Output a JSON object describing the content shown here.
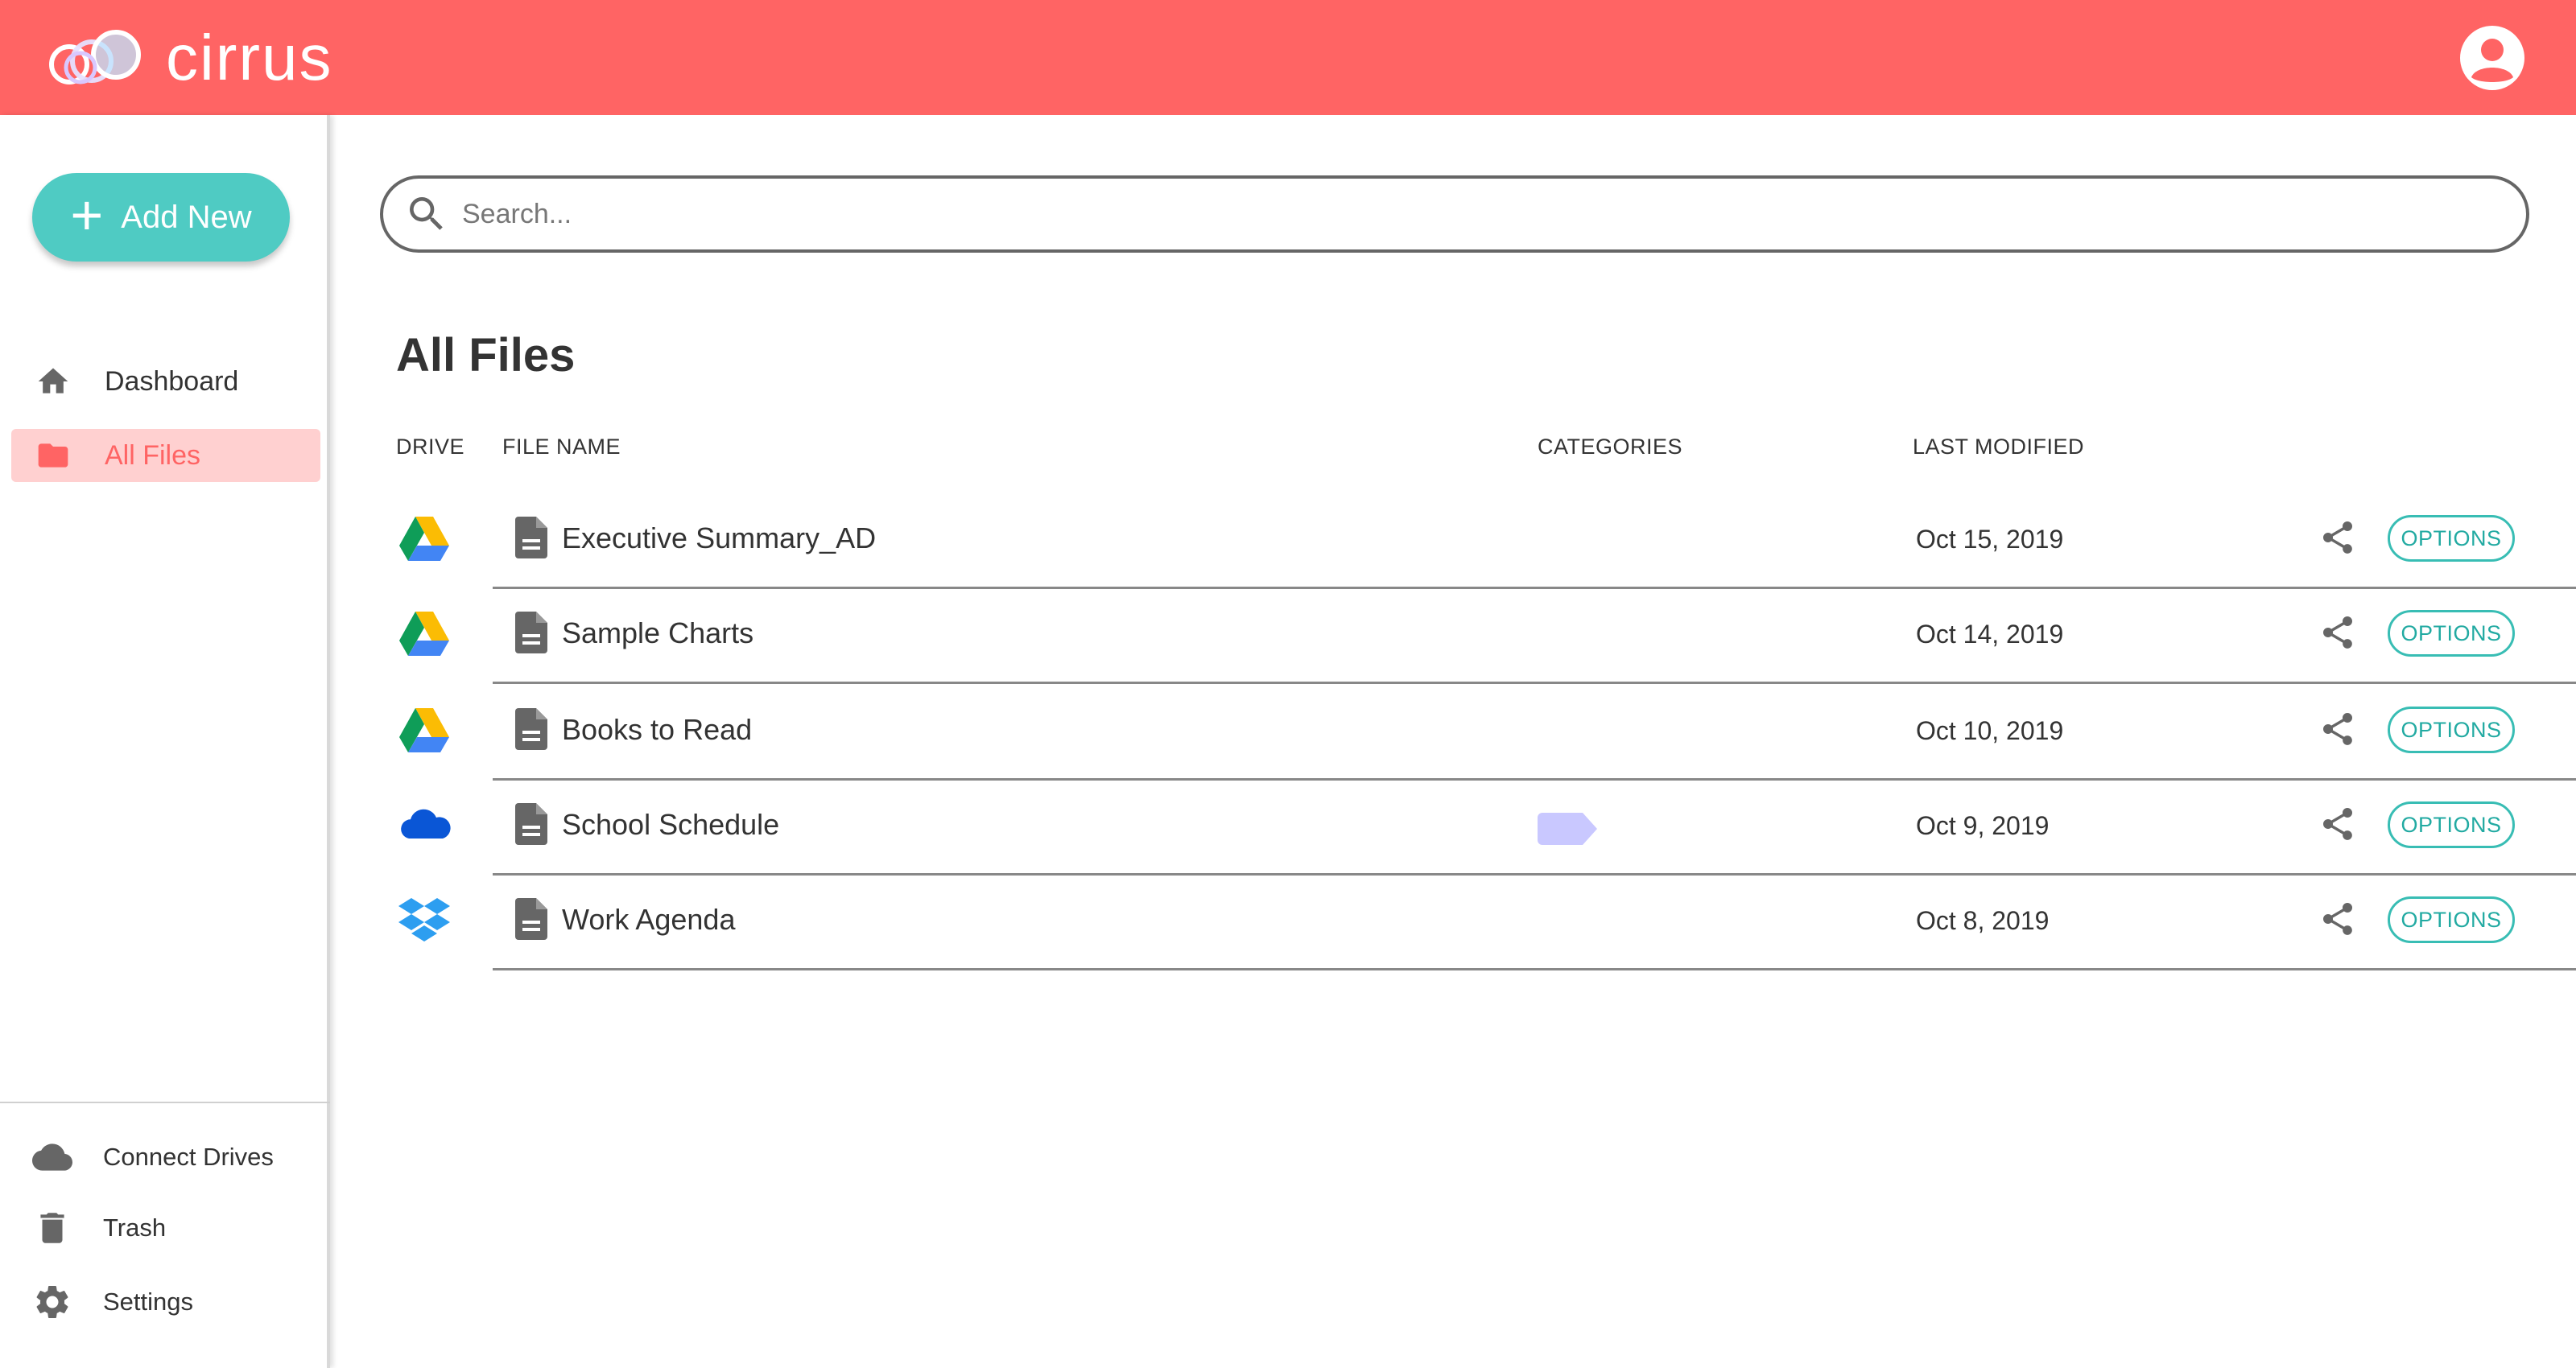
{
  "app": {
    "name": "cirrus",
    "accent": "#ff6464",
    "teal": "#4fcbc3"
  },
  "topbar": {
    "profile_icon": "user-circle-icon"
  },
  "sidebar": {
    "add_new_label": "Add New",
    "nav": [
      {
        "label": "Dashboard",
        "icon": "home-icon",
        "active": false
      },
      {
        "label": "All Files",
        "icon": "folder-icon",
        "active": true
      }
    ],
    "bottom": [
      {
        "label": "Connect Drives",
        "icon": "cloud-icon"
      },
      {
        "label": "Trash",
        "icon": "trash-icon"
      },
      {
        "label": "Settings",
        "icon": "gear-icon"
      }
    ]
  },
  "search": {
    "placeholder": "Search..."
  },
  "main": {
    "title": "All Files",
    "columns": {
      "drive": "DRIVE",
      "file_name": "FILE NAME",
      "categories": "CATEGORIES",
      "last_modified": "LAST MODIFIED"
    },
    "files": [
      {
        "drive": "google-drive",
        "name": "Executive Summary_AD",
        "category": "",
        "modified": "Oct 15, 2019",
        "options": "OPTIONS"
      },
      {
        "drive": "google-drive",
        "name": "Sample Charts",
        "category": "",
        "modified": "Oct 14, 2019",
        "options": "OPTIONS"
      },
      {
        "drive": "google-drive",
        "name": "Books to Read",
        "category": "",
        "modified": "Oct 10, 2019",
        "options": "OPTIONS"
      },
      {
        "drive": "onedrive",
        "name": "School Schedule",
        "category": "tag",
        "modified": "Oct 9, 2019",
        "options": "OPTIONS"
      },
      {
        "drive": "dropbox",
        "name": "Work Agenda",
        "category": "",
        "modified": "Oct 8, 2019",
        "options": "OPTIONS"
      }
    ]
  }
}
